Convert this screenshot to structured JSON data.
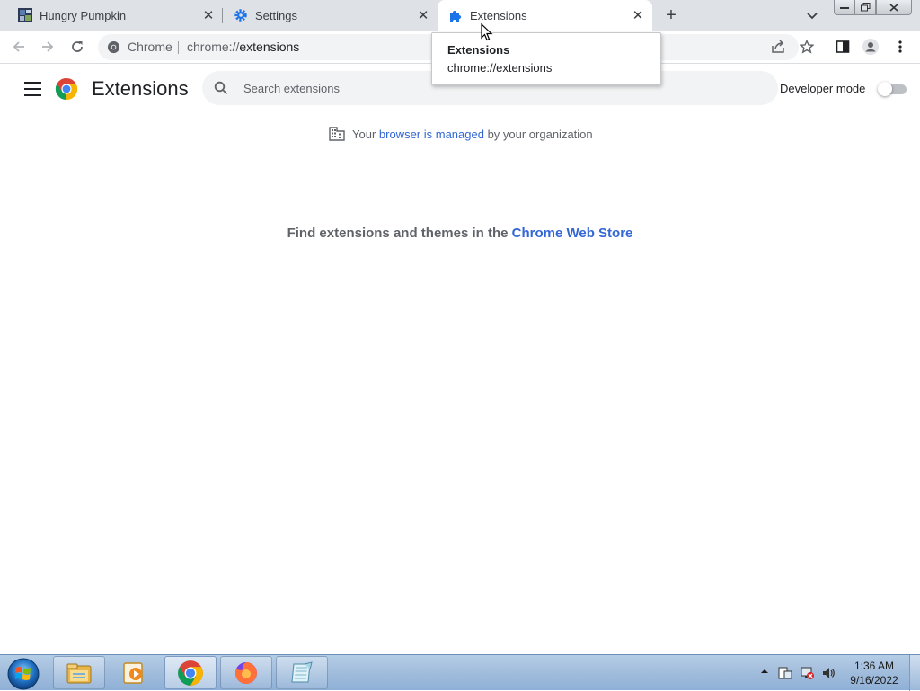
{
  "tabs": [
    {
      "title": "Hungry Pumpkin",
      "icon": "pumpkin-favicon-icon"
    },
    {
      "title": "Settings",
      "icon": "gear-icon"
    },
    {
      "title": "Extensions",
      "icon": "puzzle-icon",
      "active": true
    }
  ],
  "tooltip": {
    "title": "Extensions",
    "url": "chrome://extensions"
  },
  "omnibox": {
    "site_label": "Chrome",
    "url_scheme": "chrome://",
    "url_path": "extensions"
  },
  "page": {
    "title": "Extensions",
    "search_placeholder": "Search extensions",
    "developer_mode_label": "Developer mode",
    "developer_mode_on": false
  },
  "managed": {
    "prefix": "Your ",
    "link": "browser is managed",
    "suffix": " by your organization"
  },
  "find": {
    "prefix": "Find extensions and themes in the ",
    "link": "Chrome Web Store"
  },
  "taskbar": {
    "time": "1:36 AM",
    "date": "9/16/2022",
    "items": [
      "file-explorer-icon",
      "media-player-icon",
      "chrome-icon",
      "firefox-icon",
      "notepad-icon"
    ]
  },
  "colors": {
    "accent": "#3367d6",
    "tabstrip": "#dee1e6",
    "omnibox": "#f1f3f4"
  }
}
